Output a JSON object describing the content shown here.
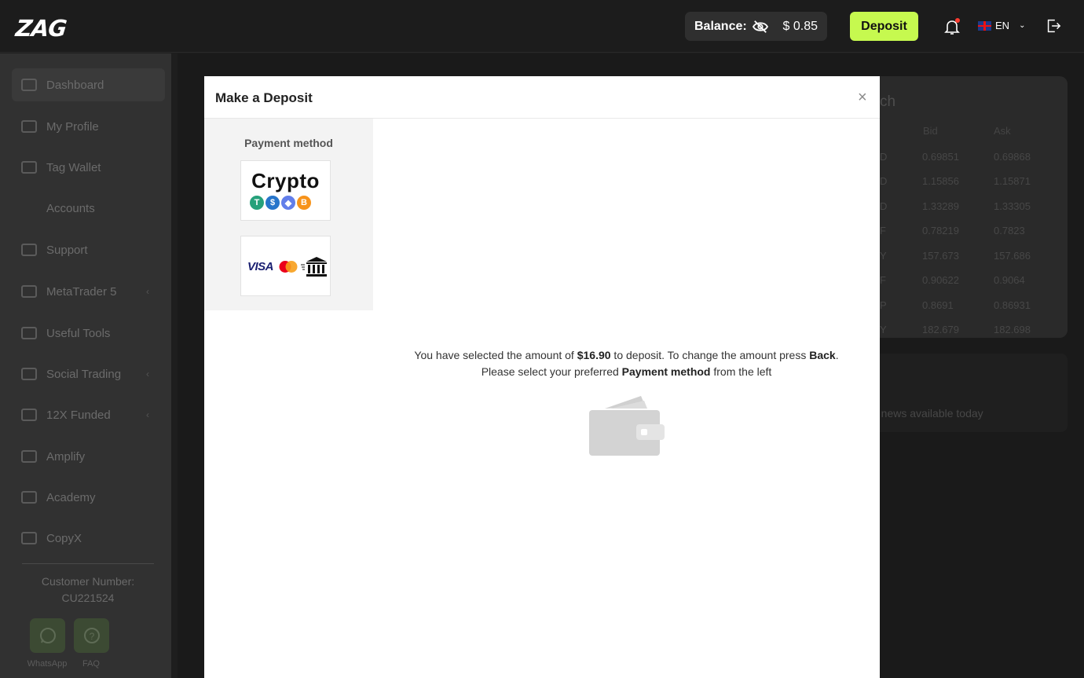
{
  "header": {
    "logo": "ZAG",
    "balance_label": "Balance:",
    "balance_amount": "$ 0.85",
    "deposit_label": "Deposit",
    "language": "EN"
  },
  "sidebar": {
    "items": [
      {
        "label": "Dashboard"
      },
      {
        "label": "My Profile"
      },
      {
        "label": "Tag Wallet"
      },
      {
        "label": "Accounts"
      },
      {
        "label": "Support"
      },
      {
        "label": "MetaTrader 5"
      },
      {
        "label": "Useful Tools"
      },
      {
        "label": "Social Trading"
      },
      {
        "label": "12X Funded"
      },
      {
        "label": "Amplify"
      },
      {
        "label": "Academy"
      },
      {
        "label": "CopyX"
      }
    ],
    "customer_label": "Customer Number:",
    "customer_number": "CU221524",
    "whatsapp_label": "WhatsApp",
    "faq_label": "FAQ"
  },
  "rates_card": {
    "title_fragment": "ch",
    "bid_header": "Bid",
    "ask_header": "Ask",
    "rows": [
      {
        "sym": "D",
        "bid": "0.69851",
        "ask": "0.69868"
      },
      {
        "sym": "D",
        "bid": "1.15856",
        "ask": "1.15871"
      },
      {
        "sym": "D",
        "bid": "1.33289",
        "ask": "1.33305"
      },
      {
        "sym": "F",
        "bid": "0.78219",
        "ask": "0.7823"
      },
      {
        "sym": "Y",
        "bid": "157.673",
        "ask": "157.686"
      },
      {
        "sym": "F",
        "bid": "0.90622",
        "ask": "0.9064"
      },
      {
        "sym": "P",
        "bid": "0.8691",
        "ask": "0.86931"
      },
      {
        "sym": "Y",
        "bid": "182.679",
        "ask": "182.698"
      }
    ]
  },
  "news": {
    "text": "o news available today"
  },
  "modal": {
    "title": "Make a Deposit",
    "close": "×",
    "payment_method_title": "Payment method",
    "crypto_label": "Crypto",
    "card_visa": "VISA",
    "msg_part1": "You have selected the amount of ",
    "msg_amount": "$16.90",
    "msg_part2": " to deposit. To change the amount press ",
    "msg_back": "Back",
    "msg_part3": ".",
    "msg_line2_part1": "Please select your preferred ",
    "msg_line2_bold": "Payment method",
    "msg_line2_part2": " from the left"
  },
  "icons": {
    "coins": [
      "tether-icon",
      "usdc-icon",
      "ethereum-icon",
      "bitcoin-icon"
    ]
  },
  "colors": {
    "accent": "#c6f94f",
    "tether": "#26a17b",
    "usdc": "#2775ca",
    "ethereum": "#627eea",
    "bitcoin": "#f7931a"
  }
}
